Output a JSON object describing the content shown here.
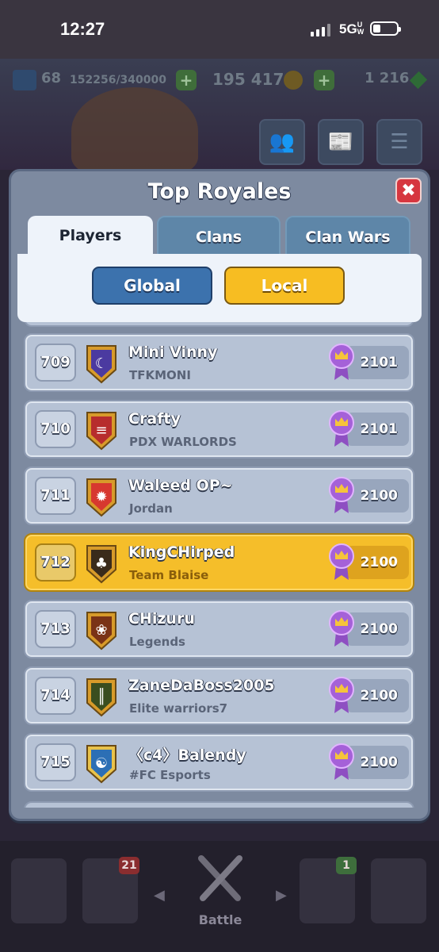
{
  "status_bar": {
    "time": "12:27",
    "network": "5G",
    "network_sup": "UW"
  },
  "resources": {
    "level": "68",
    "xp": "152256/340000",
    "gold": "195 417",
    "gems": "1 216"
  },
  "modal": {
    "title": "Top Royales",
    "tabs": [
      {
        "label": "Players",
        "active": true
      },
      {
        "label": "Clans",
        "active": false
      },
      {
        "label": "Clan Wars",
        "active": false
      }
    ],
    "filters": {
      "global": "Global",
      "local": "Local",
      "selected": "Local"
    }
  },
  "leaderboard": [
    {
      "rank": "709",
      "name": "Mini Vinny",
      "clan": "TFKMONI",
      "trophies": "2101",
      "badge": "moon",
      "highlight": false
    },
    {
      "rank": "710",
      "name": "Crafty",
      "clan": "PDX WARLORDS",
      "trophies": "2101",
      "badge": "chevron",
      "highlight": false
    },
    {
      "rank": "711",
      "name": "Waleed OP~",
      "clan": "Jordan",
      "trophies": "2100",
      "badge": "star",
      "highlight": false
    },
    {
      "rank": "712",
      "name": "KingCHirped",
      "clan": "Team Blaise",
      "trophies": "2100",
      "badge": "clover",
      "highlight": true
    },
    {
      "rank": "713",
      "name": "CHizuru",
      "clan": "Legends",
      "trophies": "2100",
      "badge": "lotus",
      "highlight": false
    },
    {
      "rank": "714",
      "name": "ZaneDaBoss2005",
      "clan": "Elite warriors7",
      "trophies": "2100",
      "badge": "bamboo",
      "highlight": false
    },
    {
      "rank": "715",
      "name": "〈c4〉Balendy",
      "clan": "#FC Esports",
      "trophies": "2100",
      "badge": "yinyang",
      "highlight": false
    }
  ],
  "bottom_nav": {
    "cards_badge": "21",
    "clan_badge": "1",
    "battle_label": "Battle"
  },
  "colors": {
    "highlight_row": "#f5be2a",
    "row": "#b6c2d5",
    "panel": "#7d8aa0",
    "global_button": "#3c72ad",
    "local_button": "#f7bd22",
    "close_button": "#d6363f"
  }
}
